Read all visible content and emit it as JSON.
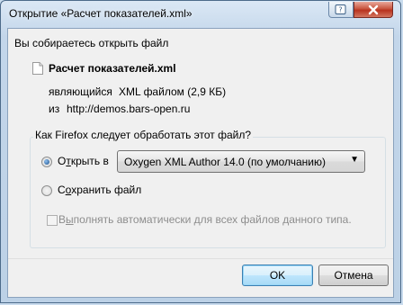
{
  "window": {
    "title": "Открытие «Расчет показателей.xml»"
  },
  "dialog": {
    "intro": "Вы собираетесь открыть файл",
    "file_name": "Расчет показателей.xml",
    "type_label": "являющийся",
    "type_value": "XML файлом (2,9 КБ)",
    "from_label": "из",
    "from_value": "http://demos.bars-open.ru",
    "group_label": "Как Firefox следует обработать этот файл?",
    "open_with_label": "Открыть в",
    "open_with_accesskey_before": "О",
    "open_with_accesskey": "т",
    "open_with_accesskey_after": "крыть в",
    "app_selected": "Oxygen XML Author 14.0 (по умолчанию)",
    "save_label_pre": "С",
    "save_label_key": "о",
    "save_label_post": "хранить файл",
    "auto_label_pre": "В",
    "auto_label_key": "ы",
    "auto_label_post": "полнять автоматически для всех файлов данного типа.",
    "open_with_checked": true,
    "save_checked": false,
    "auto_checked": false,
    "auto_disabled": true
  },
  "buttons": {
    "ok": "OK",
    "cancel": "Отмена"
  },
  "icons": {
    "help": "help-icon",
    "close": "close-icon",
    "file": "file-icon",
    "dropdown": "chevron-down-icon"
  },
  "colors": {
    "titlebar": "#c3d6ea",
    "close_button": "#c8563f",
    "default_button_border": "#3c7fb1",
    "disabled_text": "#8d8d8d"
  }
}
